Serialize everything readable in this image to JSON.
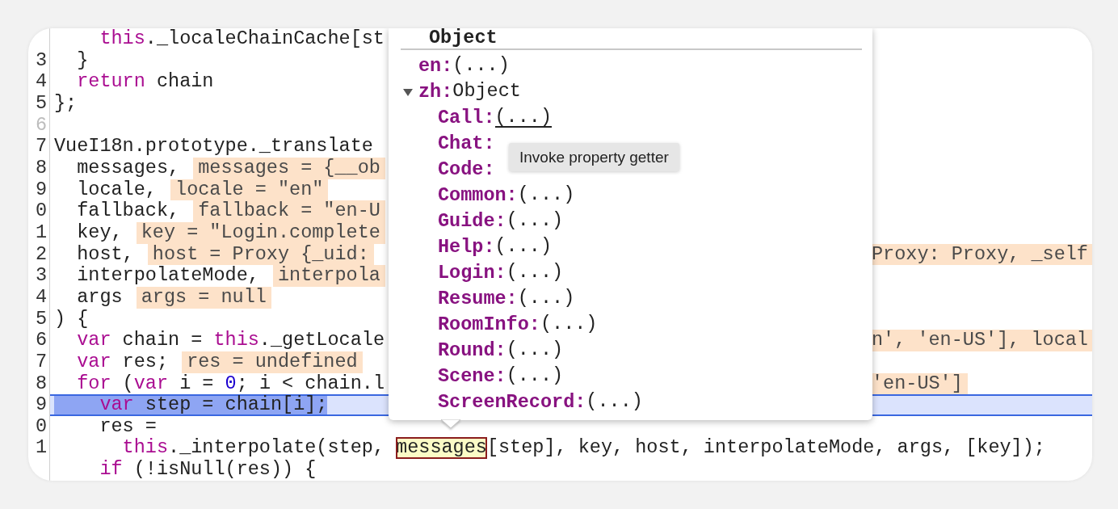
{
  "code": {
    "lines": [
      {
        "current": false,
        "tokens": [
          {
            "kind": "keyword",
            "text": "    this"
          },
          {
            "kind": "plain",
            "text": "._localeChainCache[st"
          }
        ]
      },
      {
        "number": "3",
        "breakable": true,
        "current": false,
        "tokens": [
          {
            "kind": "plain",
            "text": "  }"
          }
        ]
      },
      {
        "number": "4",
        "breakable": true,
        "current": false,
        "tokens": [
          {
            "kind": "keyword",
            "text": "  return"
          },
          {
            "kind": "plain",
            "text": " chain"
          }
        ]
      },
      {
        "number": "5",
        "breakable": true,
        "current": false,
        "tokens": [
          {
            "kind": "plain",
            "text": "};"
          }
        ]
      },
      {
        "number": "6",
        "breakable": false,
        "current": false
      },
      {
        "number": "7",
        "breakable": true,
        "current": false,
        "tokens": [
          {
            "kind": "plain",
            "text": "VueI18n.prototype._translate"
          }
        ]
      },
      {
        "number": "8",
        "breakable": true,
        "current": false,
        "tokens": [
          {
            "kind": "plain",
            "text": "  messages, "
          },
          {
            "kind": "value",
            "text": "messages = {__ob"
          }
        ]
      },
      {
        "number": "9",
        "breakable": true,
        "current": false,
        "tokens": [
          {
            "kind": "plain",
            "text": "  locale, "
          },
          {
            "kind": "value",
            "text": "locale = \"en\""
          }
        ]
      },
      {
        "number": "0",
        "breakable": true,
        "current": false,
        "tokens": [
          {
            "kind": "plain",
            "text": "  fallback, "
          },
          {
            "kind": "value",
            "text": "fallback = \"en-U"
          }
        ]
      },
      {
        "number": "1",
        "breakable": true,
        "current": false,
        "tokens": [
          {
            "kind": "plain",
            "text": "  key, "
          },
          {
            "kind": "value",
            "text": "key = \"Login.complete"
          }
        ]
      },
      {
        "number": "2",
        "breakable": true,
        "current": false,
        "tokens": [
          {
            "kind": "plain",
            "text": "  host, "
          },
          {
            "kind": "value",
            "text": "host = Proxy {_uid:"
          }
        ],
        "right": [
          {
            "kind": "value",
            "text": "Proxy: Proxy, _self"
          }
        ]
      },
      {
        "number": "3",
        "breakable": true,
        "current": false,
        "tokens": [
          {
            "kind": "plain",
            "text": "  interpolateMode, "
          },
          {
            "kind": "value",
            "text": "interpola"
          }
        ]
      },
      {
        "number": "4",
        "breakable": true,
        "current": false,
        "tokens": [
          {
            "kind": "plain",
            "text": "  args "
          },
          {
            "kind": "value",
            "text": "args = null"
          }
        ]
      },
      {
        "number": "5",
        "breakable": true,
        "current": false,
        "tokens": [
          {
            "kind": "plain",
            "text": ") {"
          }
        ]
      },
      {
        "number": "6",
        "breakable": true,
        "current": false,
        "tokens": [
          {
            "kind": "keyword",
            "text": "  var"
          },
          {
            "kind": "plain",
            "text": " chain = "
          },
          {
            "kind": "keyword",
            "text": "this"
          },
          {
            "kind": "plain",
            "text": "._getLocale"
          }
        ],
        "right": [
          {
            "kind": "value",
            "text": "n', 'en-US'], local"
          }
        ]
      },
      {
        "number": "7",
        "breakable": true,
        "current": false,
        "tokens": [
          {
            "kind": "keyword",
            "text": "  var"
          },
          {
            "kind": "plain",
            "text": " res; "
          },
          {
            "kind": "value",
            "text": "res = undefined"
          }
        ]
      },
      {
        "number": "8",
        "breakable": true,
        "current": false,
        "tokens": [
          {
            "kind": "keyword",
            "text": "  for"
          },
          {
            "kind": "plain",
            "text": " ("
          },
          {
            "kind": "keyword",
            "text": "var"
          },
          {
            "kind": "plain",
            "text": " i = "
          },
          {
            "kind": "number",
            "text": "0"
          },
          {
            "kind": "plain",
            "text": "; i < chain.l"
          }
        ],
        "right": [
          {
            "kind": "value",
            "text": "'en-US']"
          }
        ]
      },
      {
        "number": "9",
        "breakable": true,
        "current": true,
        "tokens": [
          {
            "kind": "keyword",
            "text": "    var"
          },
          {
            "kind": "plain",
            "text": " step = chain[i];"
          }
        ]
      },
      {
        "number": "0",
        "breakable": true,
        "current": false,
        "tokens": [
          {
            "kind": "plain",
            "text": "    res ="
          }
        ]
      },
      {
        "number": "1",
        "breakable": true,
        "current": false,
        "tokens": [
          {
            "kind": "keyword",
            "text": "      this"
          },
          {
            "kind": "plain",
            "text": "._interpolate(step, "
          },
          {
            "kind": "hovered",
            "text": "messages"
          },
          {
            "kind": "plain",
            "text": "[step], key, host, interpolateMode, args, [key]);"
          }
        ]
      },
      {
        "current": false,
        "tokens": [
          {
            "kind": "keyword",
            "text": "    if"
          },
          {
            "kind": "plain",
            "text": " (!isNull(res)) {"
          }
        ]
      }
    ]
  },
  "popover": {
    "title": "Object",
    "properties": [
      {
        "key": "en:",
        "value": "(...)",
        "hovered": false
      },
      {
        "key": "zh:",
        "value": "Object",
        "expanded": true,
        "hovered": false,
        "children": [
          {
            "key": "Call:",
            "value": "(...)",
            "hovered": true
          },
          {
            "key": "Chat:"
          },
          {
            "key": "Code:"
          },
          {
            "key": "Common:",
            "value": "(...)",
            "hovered": false
          },
          {
            "key": "Guide:",
            "value": "(...)",
            "hovered": false
          },
          {
            "key": "Help:",
            "value": "(...)",
            "hovered": false
          },
          {
            "key": "Login:",
            "value": "(...)",
            "hovered": false
          },
          {
            "key": "Resume:",
            "value": "(...)",
            "hovered": false
          },
          {
            "key": "RoomInfo:",
            "value": "(...)",
            "hovered": false
          },
          {
            "key": "Round:",
            "value": "(...)",
            "hovered": false
          },
          {
            "key": "Scene:",
            "value": "(...)",
            "hovered": false
          },
          {
            "key": "ScreenRecord:",
            "value": "(...)",
            "hovered": false
          }
        ]
      }
    ]
  },
  "tooltip": {
    "text": "Invoke property getter"
  }
}
